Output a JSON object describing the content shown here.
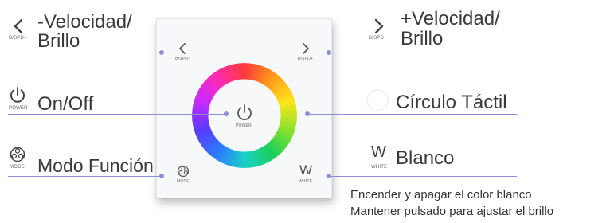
{
  "labels": {
    "speed_down": [
      "-Velocidad/",
      "Brillo"
    ],
    "speed_up": [
      "+Velocidad/",
      "Brillo"
    ],
    "onoff": "On/Off",
    "circle": "Círculo Táctil",
    "mode": "Modo Función",
    "white": "Blanco"
  },
  "icon_captions": {
    "spd_down": "B/SPD−",
    "spd_up": "B/SPD+",
    "power": "POWER",
    "mode": "MODE",
    "white": "WHITE",
    "white_letter": "W"
  },
  "white_note": [
    "Encender y apagar el color blanco",
    "Mantener pulsado para ajustar el brillo"
  ],
  "colors": {
    "leader_line": "#8d8dd6",
    "text": "#3a3a3a"
  },
  "icons": [
    "chevron-left-icon",
    "chevron-right-icon",
    "power-icon",
    "touch-ring-icon",
    "mode-fan-icon",
    "white-w-icon"
  ]
}
